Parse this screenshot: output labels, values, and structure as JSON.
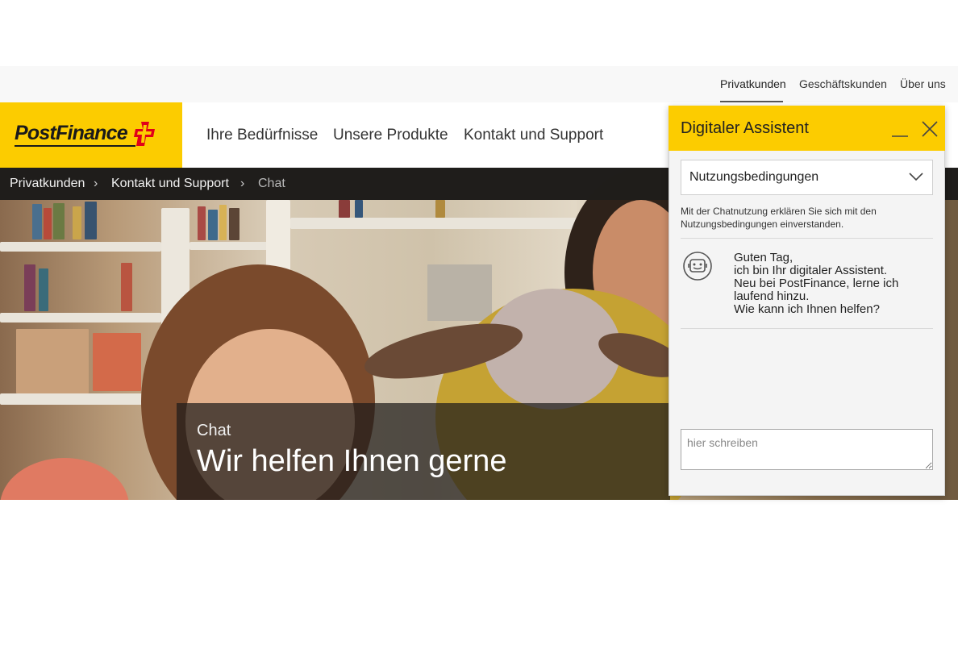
{
  "top_nav": {
    "items": [
      {
        "label": "Privatkunden",
        "active": true
      },
      {
        "label": "Geschäftskunden",
        "active": false
      },
      {
        "label": "Über uns",
        "active": false
      }
    ]
  },
  "header": {
    "logo_text": "PostFinance",
    "main_nav": [
      "Ihre Bedürfnisse",
      "Unsere Produkte",
      "Kontakt und Support"
    ]
  },
  "breadcrumb": {
    "items": [
      "Privatkunden",
      "Kontakt und Support",
      "Chat"
    ]
  },
  "hero": {
    "kicker": "Chat",
    "title": "Wir helfen Ihnen gerne"
  },
  "chat": {
    "title": "Digitaler Assistent",
    "terms_label": "Nutzungsbedingungen",
    "terms_note": "Mit der Chatnutzung erklären Sie sich mit den Nutzungsbedingungen einverstanden.",
    "bot_message_lines": [
      "Guten Tag,",
      "ich bin Ihr digitaler Assistent.",
      "Neu bei PostFinance, lerne ich",
      "laufend hinzu.",
      "Wie kann ich Ihnen helfen?"
    ],
    "input_placeholder": "hier schreiben"
  },
  "colors": {
    "brand_yellow": "#fccc00",
    "brand_red": "#e1001a"
  }
}
